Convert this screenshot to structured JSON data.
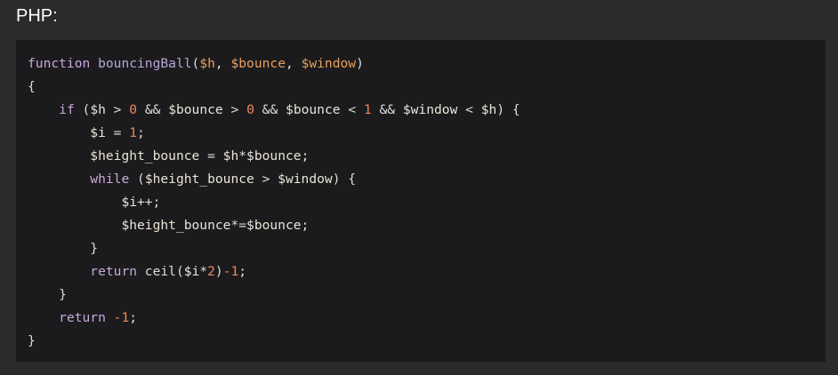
{
  "language_label": "PHP:",
  "code": {
    "lines": [
      [
        {
          "t": "function",
          "k": "kw"
        },
        {
          "t": " ",
          "k": "op"
        },
        {
          "t": "bouncingBall",
          "k": "fn"
        },
        {
          "t": "(",
          "k": "punct"
        },
        {
          "t": "$h",
          "k": "param"
        },
        {
          "t": ", ",
          "k": "punct"
        },
        {
          "t": "$bounce",
          "k": "param"
        },
        {
          "t": ", ",
          "k": "punct"
        },
        {
          "t": "$window",
          "k": "param"
        },
        {
          "t": ")",
          "k": "punct"
        }
      ],
      [
        {
          "t": "{",
          "k": "punct"
        }
      ],
      [
        {
          "t": "    ",
          "k": "op"
        },
        {
          "t": "if",
          "k": "kw"
        },
        {
          "t": " (",
          "k": "punct"
        },
        {
          "t": "$h",
          "k": "var"
        },
        {
          "t": " > ",
          "k": "op"
        },
        {
          "t": "0",
          "k": "num"
        },
        {
          "t": " && ",
          "k": "op"
        },
        {
          "t": "$bounce",
          "k": "var"
        },
        {
          "t": " > ",
          "k": "op"
        },
        {
          "t": "0",
          "k": "num"
        },
        {
          "t": " && ",
          "k": "op"
        },
        {
          "t": "$bounce",
          "k": "var"
        },
        {
          "t": " < ",
          "k": "op"
        },
        {
          "t": "1",
          "k": "num"
        },
        {
          "t": " && ",
          "k": "op"
        },
        {
          "t": "$window",
          "k": "var"
        },
        {
          "t": " < ",
          "k": "op"
        },
        {
          "t": "$h",
          "k": "var"
        },
        {
          "t": ") {",
          "k": "punct"
        }
      ],
      [
        {
          "t": "        ",
          "k": "op"
        },
        {
          "t": "$i",
          "k": "var"
        },
        {
          "t": " = ",
          "k": "op"
        },
        {
          "t": "1",
          "k": "num"
        },
        {
          "t": ";",
          "k": "punct"
        }
      ],
      [
        {
          "t": "        ",
          "k": "op"
        },
        {
          "t": "$height_bounce",
          "k": "var"
        },
        {
          "t": " = ",
          "k": "op"
        },
        {
          "t": "$h",
          "k": "var"
        },
        {
          "t": "*",
          "k": "op"
        },
        {
          "t": "$bounce",
          "k": "var"
        },
        {
          "t": ";",
          "k": "punct"
        }
      ],
      [
        {
          "t": "        ",
          "k": "op"
        },
        {
          "t": "while",
          "k": "kw"
        },
        {
          "t": " (",
          "k": "punct"
        },
        {
          "t": "$height_bounce",
          "k": "var"
        },
        {
          "t": " > ",
          "k": "op"
        },
        {
          "t": "$window",
          "k": "var"
        },
        {
          "t": ") {",
          "k": "punct"
        }
      ],
      [
        {
          "t": "            ",
          "k": "op"
        },
        {
          "t": "$i",
          "k": "var"
        },
        {
          "t": "++;",
          "k": "op"
        }
      ],
      [
        {
          "t": "            ",
          "k": "op"
        },
        {
          "t": "$height_bounce",
          "k": "var"
        },
        {
          "t": "*=",
          "k": "op"
        },
        {
          "t": "$bounce",
          "k": "var"
        },
        {
          "t": ";",
          "k": "punct"
        }
      ],
      [
        {
          "t": "        ",
          "k": "op"
        },
        {
          "t": "}",
          "k": "punct"
        }
      ],
      [
        {
          "t": "        ",
          "k": "op"
        },
        {
          "t": "return",
          "k": "kw"
        },
        {
          "t": " ceil(",
          "k": "op"
        },
        {
          "t": "$i",
          "k": "var"
        },
        {
          "t": "*",
          "k": "op"
        },
        {
          "t": "2",
          "k": "num"
        },
        {
          "t": ")",
          "k": "punct"
        },
        {
          "t": "-1",
          "k": "num"
        },
        {
          "t": ";",
          "k": "punct"
        }
      ],
      [
        {
          "t": "    ",
          "k": "op"
        },
        {
          "t": "}",
          "k": "punct"
        }
      ],
      [
        {
          "t": "    ",
          "k": "op"
        },
        {
          "t": "return",
          "k": "kw"
        },
        {
          "t": " ",
          "k": "op"
        },
        {
          "t": "-1",
          "k": "num"
        },
        {
          "t": ";",
          "k": "punct"
        }
      ],
      [
        {
          "t": "}",
          "k": "punct"
        }
      ]
    ]
  },
  "colors": {
    "page_background": "#2b2b2d",
    "code_background": "#1b1b1d",
    "keyword": "#c8a8dc",
    "function_name": "#b9a5d8",
    "parameter": "#e8a05c",
    "number": "#f0865a",
    "variable": "#eae4d8"
  }
}
